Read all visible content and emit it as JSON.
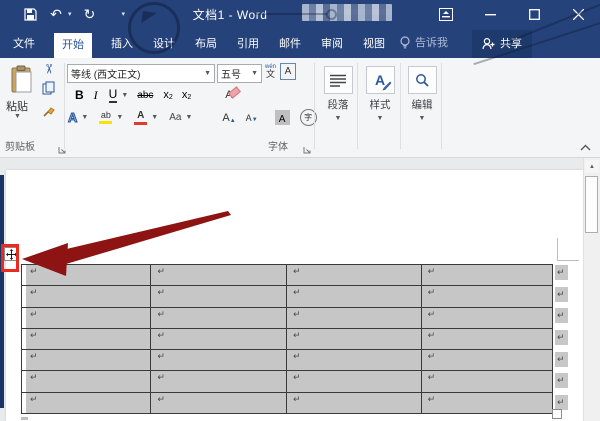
{
  "titlebar": {
    "title": "文档1 - Word",
    "qat": {
      "save": "save-icon",
      "undo": "undo-icon",
      "redo": "redo-icon",
      "customize": "customize-qat"
    },
    "window_controls": {
      "ribbon_display": "ribbon-display-options",
      "minimize": "−",
      "maximize": "□",
      "close": "×"
    }
  },
  "tabs": {
    "items": [
      {
        "label": "文件",
        "active": false
      },
      {
        "label": "开始",
        "active": true
      },
      {
        "label": "插入",
        "active": false
      },
      {
        "label": "设计",
        "active": false
      },
      {
        "label": "布局",
        "active": false
      },
      {
        "label": "引用",
        "active": false
      },
      {
        "label": "邮件",
        "active": false
      },
      {
        "label": "审阅",
        "active": false
      },
      {
        "label": "视图",
        "active": false
      }
    ],
    "tell_me": "告诉我",
    "share": "共享"
  },
  "ribbon": {
    "clipboard": {
      "paste_label": "粘贴",
      "group_label": "剪贴板"
    },
    "font": {
      "font_name": "等线 (西文正文)",
      "font_size": "五号",
      "bold": "B",
      "italic": "I",
      "underline": "U",
      "strikethrough": "abc",
      "subscript_base": "x",
      "subscript_mark": "2",
      "superscript_base": "x",
      "superscript_mark": "2",
      "clear_format": "A",
      "text_effects": "A",
      "highlight": "ab",
      "font_color": "A",
      "change_case": "Aa",
      "grow_font": "A",
      "shrink_font": "A",
      "char_shading": "A",
      "enclose_char": "字",
      "phonetic_top": "wén",
      "phonetic_bottom": "文",
      "char_border": "A",
      "group_label": "字体"
    },
    "paragraph": {
      "group_label": "段落"
    },
    "styles": {
      "group_label": "样式",
      "icon_letter": "A"
    },
    "editing": {
      "group_label": "编辑"
    }
  },
  "document": {
    "table": {
      "rows": 7,
      "cols": 4,
      "cell_marker": "↵",
      "end_of_row_marker": "↵"
    },
    "annotation": {
      "type": "red-arrow-pointing-at-table-move-handle"
    }
  },
  "colors": {
    "titlebar_blue": "#26427a",
    "share_box_blue": "#1e3a6d",
    "active_tab_text": "#2b579a",
    "accent_blue": "#2b579a",
    "table_selection_gray": "#c6c6c6",
    "annotation_red": "#ea2a1e",
    "arrow_maroon": "#8d1413",
    "highlight_yellow": "#ffe100",
    "font_color_red": "#e03a30"
  }
}
